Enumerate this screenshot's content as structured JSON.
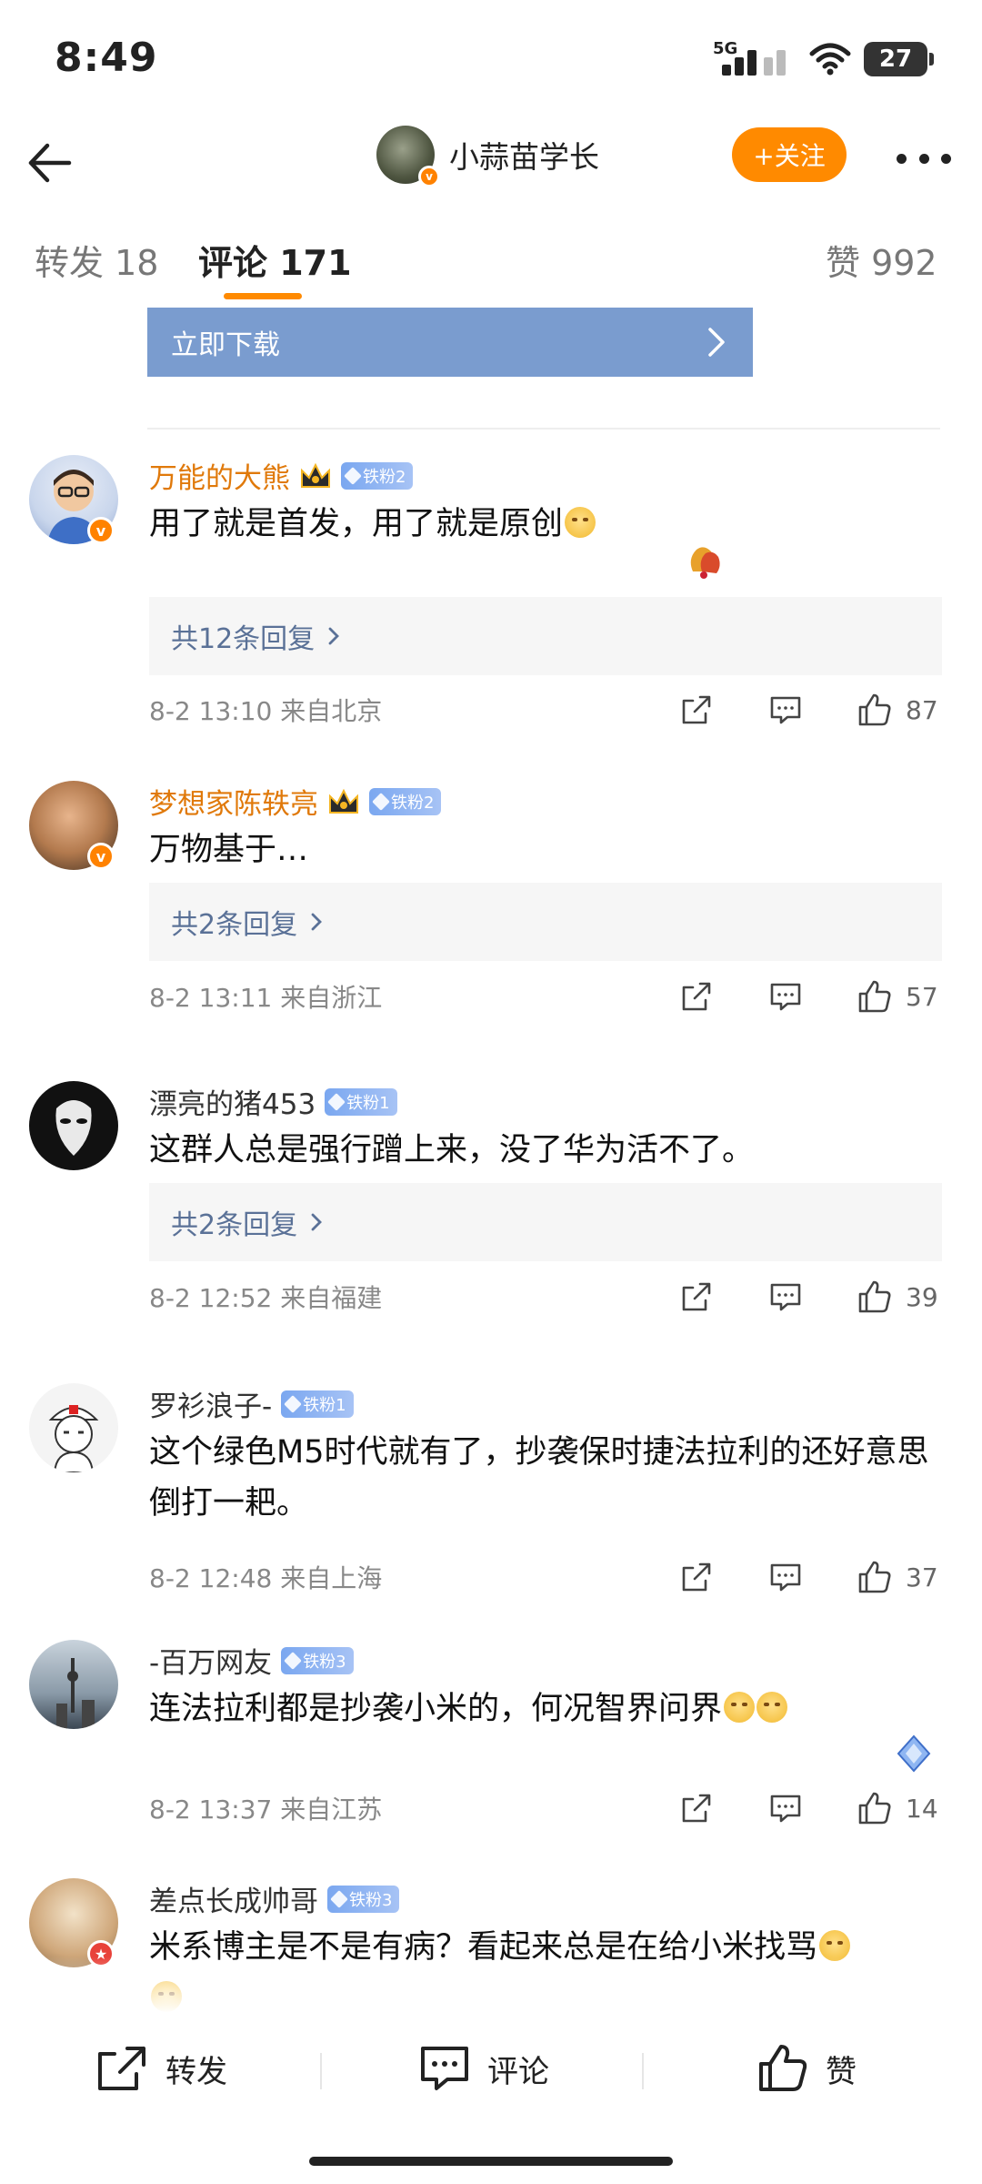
{
  "status": {
    "time": "8:49",
    "network": "5G",
    "battery": "27"
  },
  "header": {
    "author_name": "小蒜苗学长",
    "follow_label": "+关注"
  },
  "tabs": [
    {
      "label": "转发 18"
    },
    {
      "label": "评论 171"
    },
    {
      "label": "赞 992"
    }
  ],
  "banner": {
    "label": "立即下载"
  },
  "comments": [
    {
      "username": "万能的大熊",
      "fan_badge": "铁粉2",
      "text": "用了就是首发，用了就是原创",
      "replies": "共12条回复",
      "meta": "8-2 13:10  来自北京",
      "likes": "87"
    },
    {
      "username": "梦想家陈轶亮",
      "fan_badge": "铁粉2",
      "text": "万物基于…",
      "replies": "共2条回复",
      "meta": "8-2 13:11  来自浙江",
      "likes": "57"
    },
    {
      "username": "漂亮的猪453",
      "fan_badge": "铁粉1",
      "text": "这群人总是强行蹭上来，没了华为活不了。",
      "replies": "共2条回复",
      "meta": "8-2 12:52  来自福建",
      "likes": "39"
    },
    {
      "username": "罗衫浪子-",
      "fan_badge": "铁粉1",
      "text": "这个绿色M5时代就有了，抄袭保时捷法拉利的还好意思倒打一耙。",
      "meta": "8-2 12:48  来自上海",
      "likes": "37"
    },
    {
      "username": "-百万网友",
      "fan_badge": "铁粉3",
      "text": "连法拉利都是抄袭小米的，何况智界问界",
      "meta": "8-2 13:37  来自江苏",
      "likes": "14"
    },
    {
      "username": "差点长成帅哥",
      "fan_badge": "铁粉3",
      "text": "米系博主是不是有病？看起来总是在给小米找骂"
    }
  ],
  "bottom": {
    "repost": "转发",
    "comment": "评论",
    "like": "赞"
  },
  "colors": {
    "accent": "#ff8a00",
    "reply_link": "#5a7197",
    "banner": "#7a9ccf"
  }
}
